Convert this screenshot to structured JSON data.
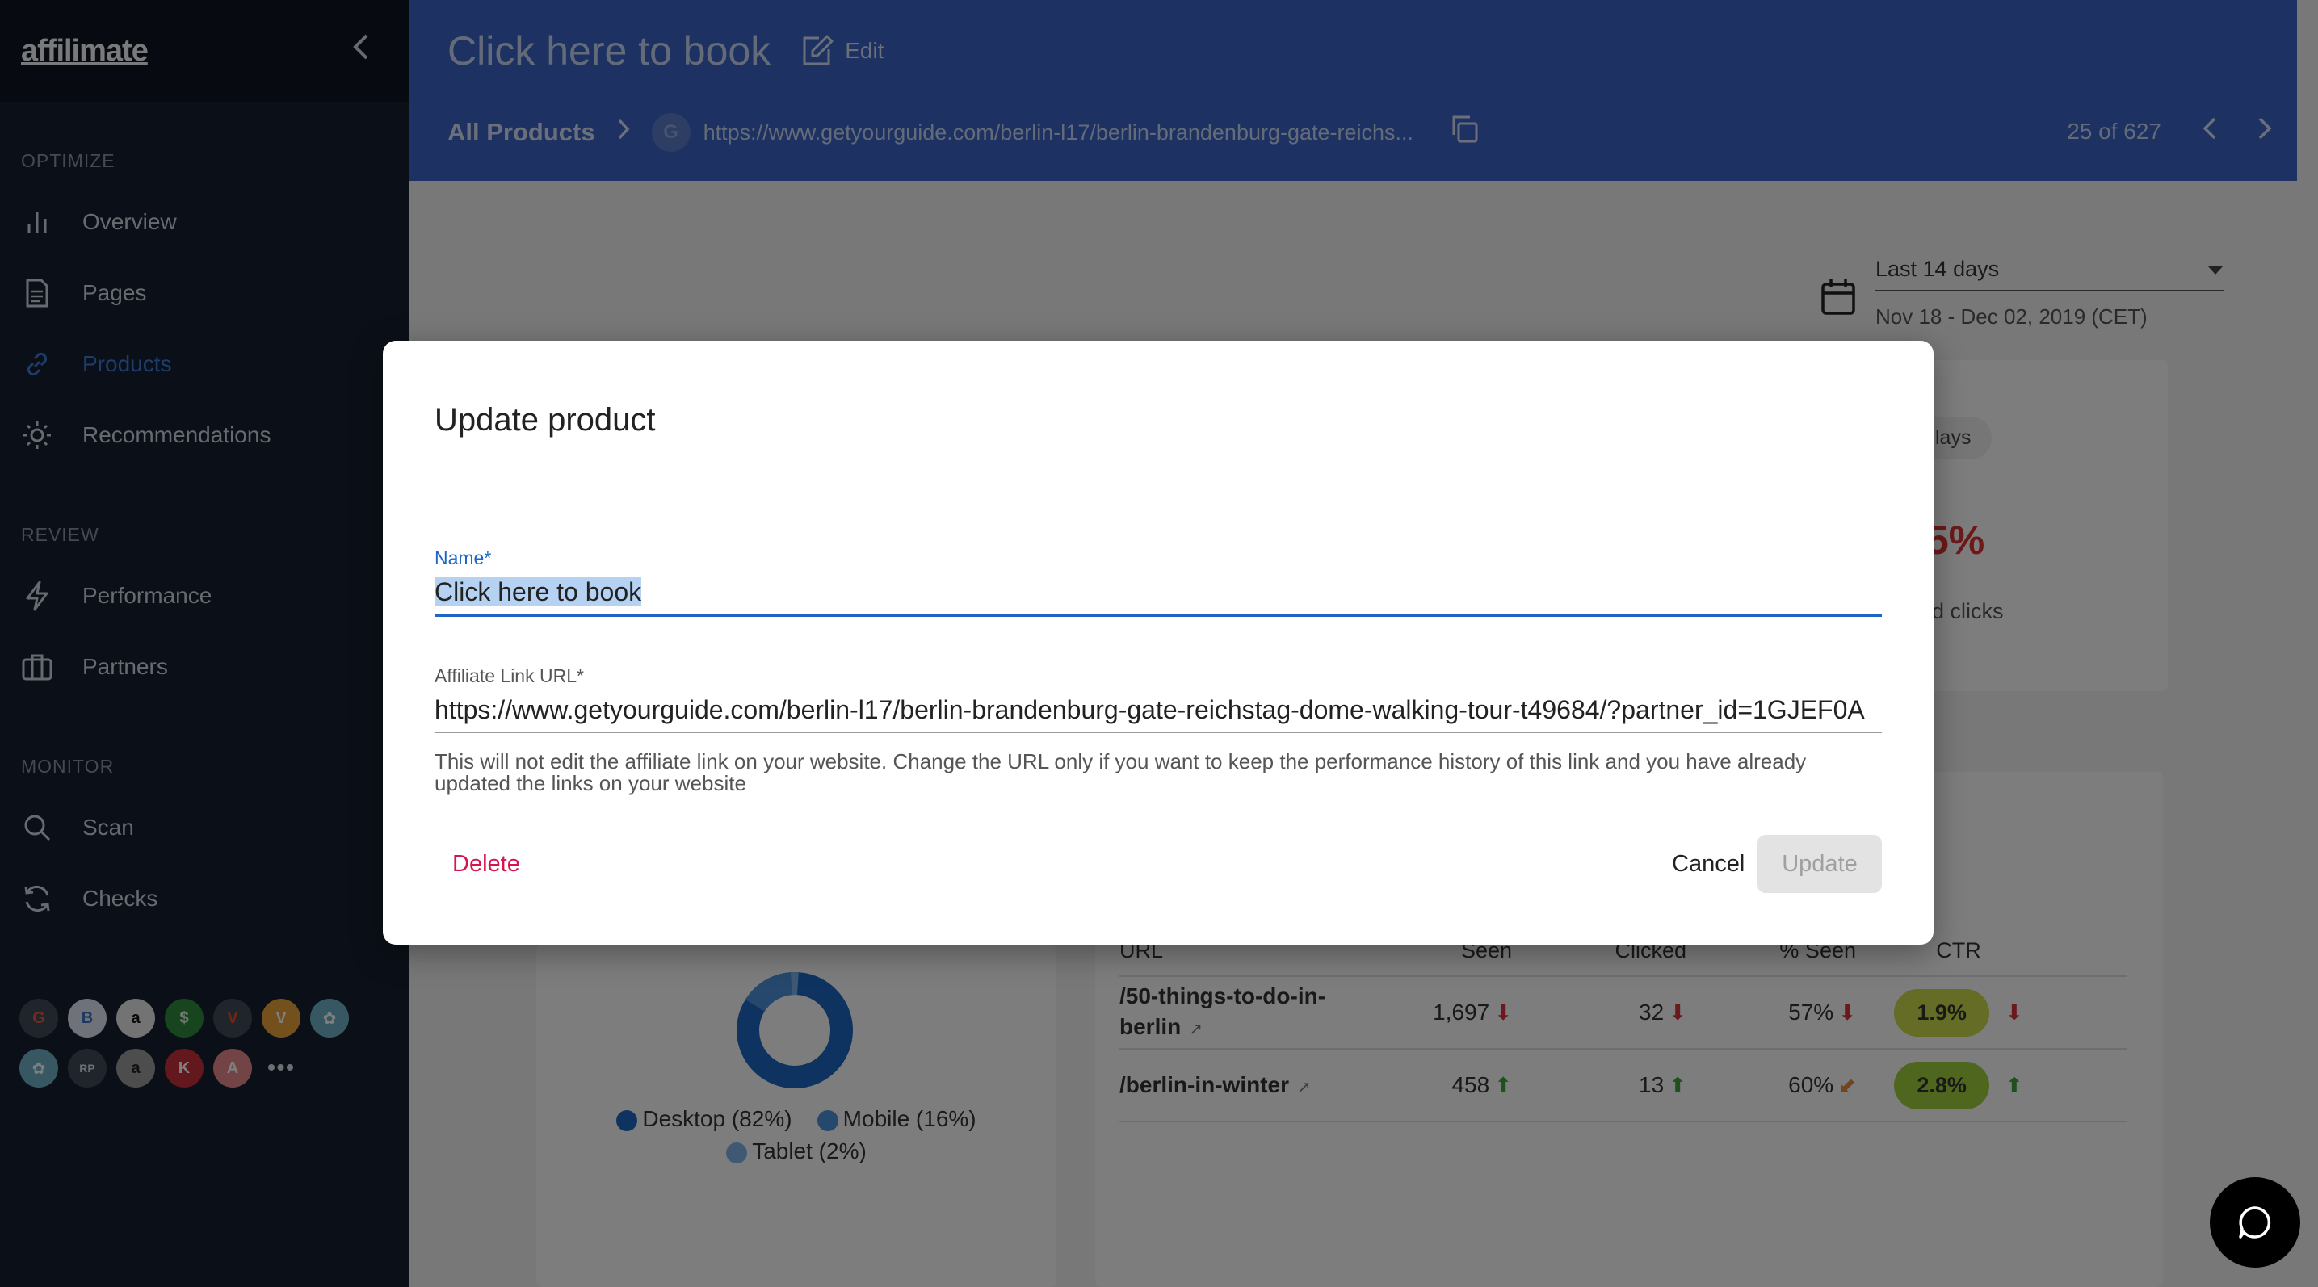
{
  "app": {
    "logo": "affilimate",
    "collapse_icon": "chevron-left-icon"
  },
  "sidebar": {
    "sections": [
      {
        "label": "OPTIMIZE",
        "items": [
          {
            "label": "Overview",
            "icon": "bar-chart-icon"
          },
          {
            "label": "Pages",
            "icon": "document-icon"
          },
          {
            "label": "Products",
            "icon": "link-icon",
            "active": true
          },
          {
            "label": "Recommendations",
            "icon": "sun-icon"
          }
        ]
      },
      {
        "label": "REVIEW",
        "items": [
          {
            "label": "Performance",
            "icon": "lightning-icon"
          },
          {
            "label": "Partners",
            "icon": "briefcase-icon"
          }
        ]
      },
      {
        "label": "MONITOR",
        "items": [
          {
            "label": "Scan",
            "icon": "search-icon"
          },
          {
            "label": "Checks",
            "icon": "refresh-icon"
          }
        ]
      }
    ],
    "partners": [
      "G",
      "B",
      "a",
      "$",
      "V",
      "V",
      "✿",
      "✿",
      "RP",
      "a",
      "K",
      "A"
    ],
    "more": "•••"
  },
  "header": {
    "title": "Click here to book",
    "edit_label": "Edit",
    "breadcrumb_root": "All Products",
    "breadcrumb_badge": "G",
    "breadcrumb_url": "https://www.getyourguide.com/berlin-l17/berlin-brandenburg-gate-reichs...",
    "pager": "25 of 627"
  },
  "date_filter": {
    "range_label": "Last 14 days",
    "date_range": "Nov 18 - Dec 02, 2019 (CET)"
  },
  "background_stats": {
    "chip": "lays",
    "percent": "5%",
    "clicks_label": "d clicks"
  },
  "device_legend": {
    "desktop": "Desktop (82%)",
    "mobile": "Mobile (16%)",
    "tablet": "Tablet (2%)"
  },
  "table": {
    "headers": {
      "url": "URL",
      "seen": "Seen",
      "clicked": "Clicked",
      "pct_seen": "% Seen",
      "ctr": "CTR"
    },
    "rows": [
      {
        "url": "/50-things-to-do-in-berlin",
        "seen": "1,697",
        "clicked": "32",
        "pct_seen": "57%",
        "ctr": "1.9%"
      },
      {
        "url": "/berlin-in-winter",
        "seen": "458",
        "clicked": "13",
        "pct_seen": "60%",
        "ctr": "2.8%"
      }
    ]
  },
  "modal": {
    "title": "Update product",
    "name_label": "Name",
    "name_value": "Click here to book",
    "url_label": "Affiliate Link URL",
    "url_value": "https://www.getyourguide.com/berlin-l17/berlin-brandenburg-gate-reichstag-dome-walking-tour-t49684/?partner_id=1GJEF0A",
    "helper": "This will not edit the affiliate link on your website. Change the URL only if you want to keep the performance history of this link and you have already updated the links on your website",
    "delete_label": "Delete",
    "cancel_label": "Cancel",
    "update_label": "Update",
    "required_mark": "*"
  },
  "colors": {
    "header": "#3a64c4",
    "sidebar": "#172030",
    "accent": "#1d66c3",
    "danger": "#d8114f",
    "ctr_low": "#c8d84a",
    "ctr_high": "#9fcd3f"
  }
}
